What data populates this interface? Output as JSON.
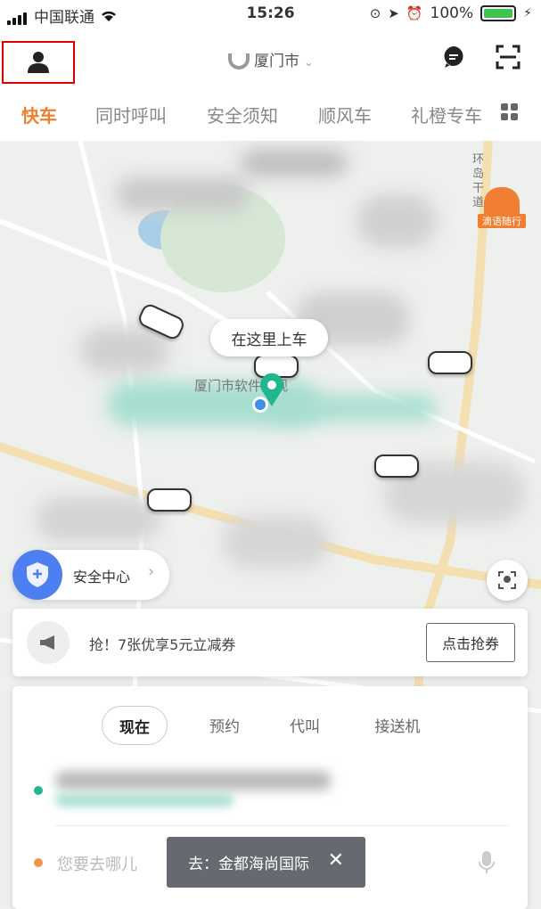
{
  "status_bar": {
    "carrier": "中国联通",
    "time": "15:26",
    "battery": "100%"
  },
  "header": {
    "city": "厦门市"
  },
  "tabs": [
    {
      "label": "快车"
    },
    {
      "label": "同时呼叫"
    },
    {
      "label": "安全须知"
    },
    {
      "label": "顺风车"
    },
    {
      "label": "礼橙专车"
    }
  ],
  "map": {
    "pickup_label": "在这里上车",
    "poi_label": "厦门市软件园观",
    "road_label": "环岛干道",
    "brand_badge": "滴语随行"
  },
  "safety": {
    "label": "安全中心"
  },
  "coupon": {
    "text": "抢！7张优享5元立减券",
    "button": "点击抢券"
  },
  "booking": {
    "modes": [
      {
        "label": "现在"
      },
      {
        "label": "预约"
      },
      {
        "label": "代叫"
      },
      {
        "label": "接送机"
      }
    ],
    "destination_placeholder": "您要去哪儿",
    "suggestion": "去：金都海尚国际"
  },
  "colors": {
    "accent": "#f07f32",
    "pickup_dot": "#21b68f",
    "dest_dot": "#f0954c",
    "highlight_box": "#e00000"
  }
}
